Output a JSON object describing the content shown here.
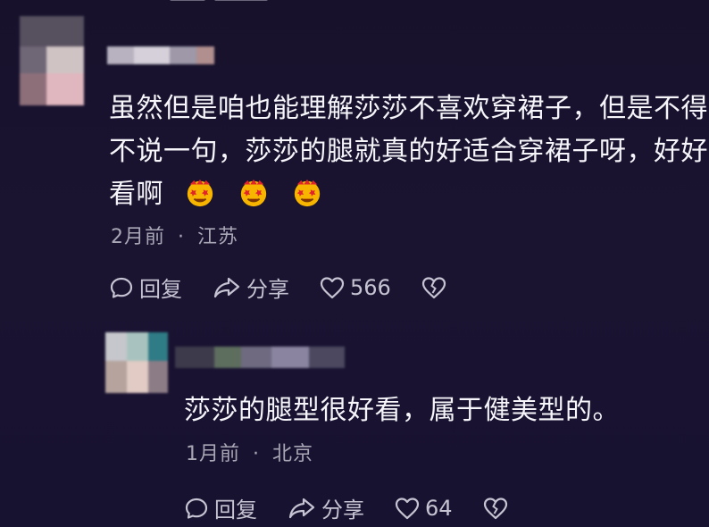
{
  "comments": [
    {
      "text_line1": "虽然但是咱也能理解莎莎不喜欢穿裙子，但是不得",
      "text_line2": "不说一句，莎莎的腿就真的好适合穿裙子呀，好好",
      "text_line3": "看啊",
      "emoji_count": 3,
      "time": "2月前",
      "separator": "·",
      "location": "江苏",
      "reply_label": "回复",
      "share_label": "分享",
      "like_count": "566"
    },
    {
      "text": "莎莎的腿型很好看，属于健美型的。",
      "time": "1月前",
      "separator": "·",
      "location": "北京",
      "reply_label": "回复",
      "share_label": "分享",
      "like_count": "64"
    }
  ],
  "icons": {
    "reply": "reply-icon",
    "share": "share-icon",
    "like": "heart-icon",
    "dislike": "broken-heart-icon",
    "emoji": "star-eyes-face-icon"
  },
  "colors": {
    "background": "#181231",
    "text": "#f6f5fa",
    "meta": "#a9a6b6",
    "action": "#c6c3d2"
  }
}
